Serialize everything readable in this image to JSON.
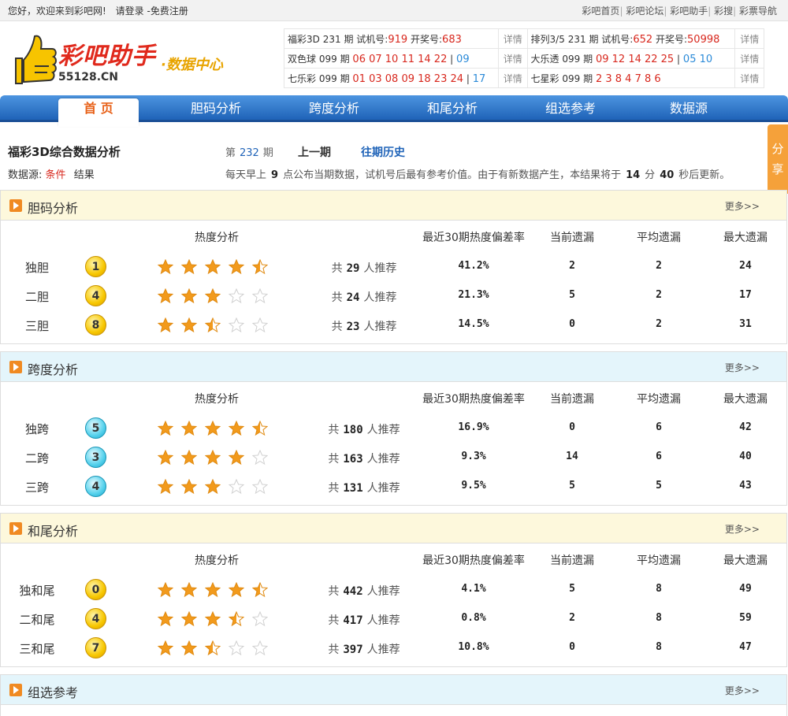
{
  "topbar": {
    "welcome": "您好，欢迎来到彩吧网!",
    "login": "请登录",
    "register": "-免费注册",
    "links": [
      "彩吧首页",
      "彩吧论坛",
      "彩吧助手",
      "彩搜",
      "彩票导航"
    ]
  },
  "logo": {
    "text": "彩吧助手",
    "site": "55128.CN",
    "sub": "·数据中心"
  },
  "draws": {
    "more": "详情",
    "row1": {
      "l_name": "福彩3D",
      "l_issue": "231",
      "l_unit": "期",
      "l_tk": "试机号:",
      "l_tkv": "919",
      "l_kj": "开奖号:",
      "l_kjv": "683",
      "r_name": "排列3/5",
      "r_issue": "231",
      "r_unit": "期",
      "r_tk": "试机号:",
      "r_tkv": "652",
      "r_kj": "开奖号:",
      "r_kjv": "50998"
    },
    "row2": {
      "l_name": "双色球",
      "l_issue": "099",
      "l_unit": "期",
      "l_red": "06 07 10 11 14 22",
      "l_sep": "|",
      "l_blue": "09",
      "r_name": "大乐透",
      "r_issue": "099",
      "r_unit": "期",
      "r_red": "09 12 14 22 25",
      "r_sep": "|",
      "r_blue": "05 10"
    },
    "row3": {
      "l_name": "七乐彩",
      "l_issue": "099",
      "l_unit": "期",
      "l_red": "01 03 08 09 18 23 24",
      "l_sep": "|",
      "l_blue": "17",
      "r_name": "七星彩",
      "r_issue": "099",
      "r_unit": "期",
      "r_red": "2 3 8 4 7 8 6"
    }
  },
  "nav": [
    "首 页",
    "胆码分析",
    "跨度分析",
    "和尾分析",
    "组选参考",
    "数据源"
  ],
  "side": {
    "a": "分",
    "b": "享"
  },
  "header": {
    "title": "福彩3D综合数据分析",
    "src_label": "数据源:",
    "src_cond": "条件",
    "src_result": "结果",
    "issue_pre": "第",
    "issue_num": "232",
    "issue_post": "期",
    "prev": "上一期",
    "history": "往期历史",
    "notice_a": "每天早上",
    "notice_h": "9",
    "notice_b": "点公布当期数据，试机号后最有参考价值。由于有新数据产生，本结果将于",
    "notice_m": "14",
    "notice_c": "分",
    "notice_s": "40",
    "notice_d": "秒后更新。"
  },
  "cols": {
    "heat": "热度分析",
    "dev": "最近30期热度偏差率",
    "cur": "当前遗漏",
    "avg": "平均遗漏",
    "max": "最大遗漏",
    "rec_pre": "共",
    "rec_post": "人推荐"
  },
  "more_label": "更多>>",
  "panels": [
    {
      "title": "胆码分析",
      "rows": [
        {
          "name": "独胆",
          "ball": "1",
          "stars": 4.5,
          "count": "29",
          "dev": "41.2%",
          "cur": "2",
          "avg": "2",
          "max": "24"
        },
        {
          "name": "二胆",
          "ball": "4",
          "stars": 3,
          "count": "24",
          "dev": "21.3%",
          "cur": "5",
          "avg": "2",
          "max": "17"
        },
        {
          "name": "三胆",
          "ball": "8",
          "stars": 2.5,
          "count": "23",
          "dev": "14.5%",
          "cur": "0",
          "avg": "2",
          "max": "31"
        }
      ]
    },
    {
      "title": "跨度分析",
      "rows": [
        {
          "name": "独跨",
          "ball": "5",
          "stars": 4.5,
          "count": "180",
          "dev": "16.9%",
          "cur": "0",
          "avg": "6",
          "max": "42"
        },
        {
          "name": "二跨",
          "ball": "3",
          "stars": 4,
          "count": "163",
          "dev": "9.3%",
          "cur": "14",
          "avg": "6",
          "max": "40"
        },
        {
          "name": "三跨",
          "ball": "4",
          "stars": 3,
          "count": "131",
          "dev": "9.5%",
          "cur": "5",
          "avg": "5",
          "max": "43"
        }
      ]
    },
    {
      "title": "和尾分析",
      "rows": [
        {
          "name": "独和尾",
          "ball": "0",
          "stars": 4.5,
          "count": "442",
          "dev": "4.1%",
          "cur": "5",
          "avg": "8",
          "max": "49"
        },
        {
          "name": "二和尾",
          "ball": "4",
          "stars": 3.5,
          "count": "417",
          "dev": "0.8%",
          "cur": "2",
          "avg": "8",
          "max": "59"
        },
        {
          "name": "三和尾",
          "ball": "7",
          "stars": 2.5,
          "count": "397",
          "dev": "10.8%",
          "cur": "0",
          "avg": "8",
          "max": "47"
        }
      ]
    },
    {
      "title": "组选参考"
    }
  ],
  "colors": {
    "red": "#d8281e",
    "blue": "#2a8ad8",
    "star": "#f29a1c",
    "star_empty": "#e2e2e2"
  }
}
